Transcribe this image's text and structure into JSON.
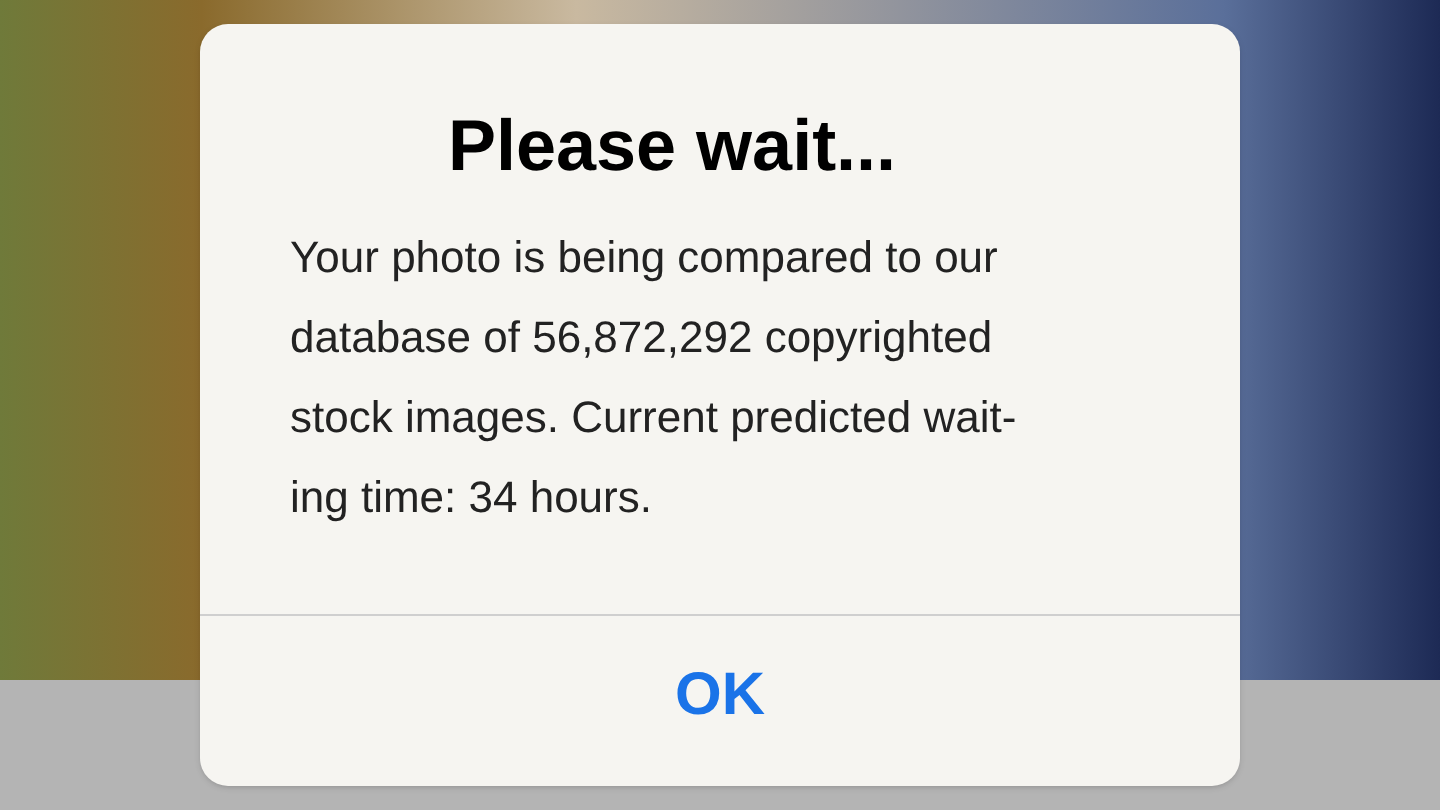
{
  "alert": {
    "title": "Please wait...",
    "message": "Your photo is being compared to our\ndatabase of 56,872,292 copyrighted\nstock images. Current predicted wait-\ning time: 34 hours.",
    "buttons": [
      "OK"
    ]
  }
}
